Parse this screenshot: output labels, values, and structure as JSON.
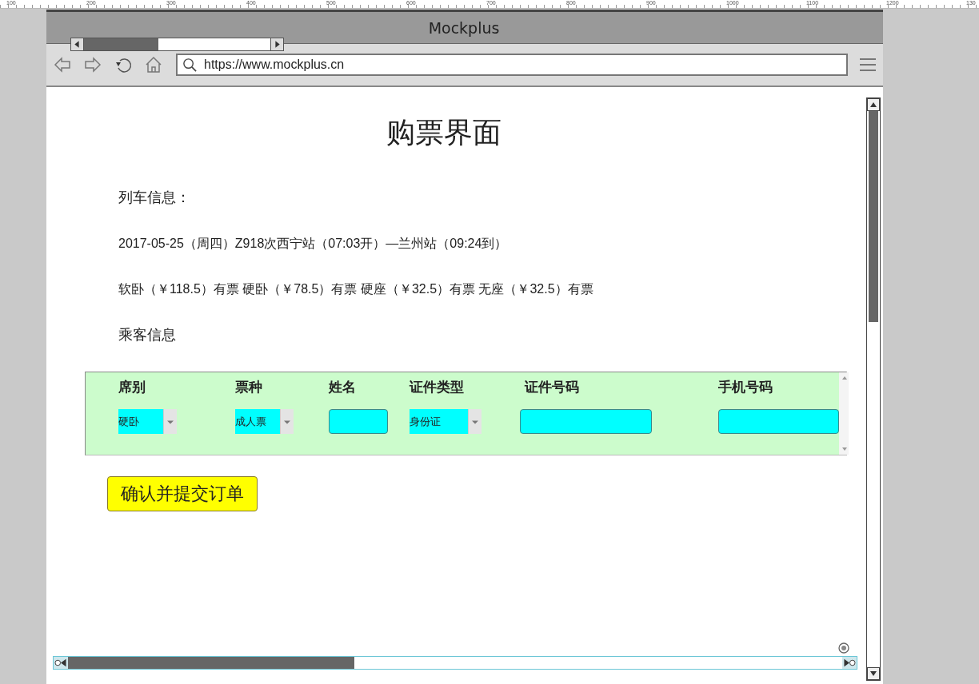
{
  "ruler": [
    "100",
    "200",
    "300",
    "400",
    "500",
    "600",
    "700",
    "800",
    "900",
    "1000",
    "1100",
    "1200",
    "130"
  ],
  "window": {
    "title": "Mockplus"
  },
  "address_bar": {
    "value": "https://www.mockplus.cn"
  },
  "page": {
    "title": "购票界面",
    "train_label": "列车信息：",
    "train_info": "2017-05-25（周四）Z918次西宁站（07:03开）—兰州站（09:24到）",
    "prices": "软卧（￥118.5）有票 硬卧（￥78.5）有票 硬座（￥32.5）有票 无座（￥32.5）有票",
    "passenger_label": "乘客信息"
  },
  "form": {
    "columns": [
      {
        "header": "席别",
        "kind": "select",
        "value": "硬卧"
      },
      {
        "header": "票种",
        "kind": "select",
        "value": "成人票"
      },
      {
        "header": "姓名",
        "kind": "input"
      },
      {
        "header": "证件类型",
        "kind": "select",
        "value": "身份证"
      },
      {
        "header": "证件号码",
        "kind": "input"
      },
      {
        "header": "手机号码",
        "kind": "input"
      }
    ]
  },
  "submit_button": "确认并提交订单"
}
